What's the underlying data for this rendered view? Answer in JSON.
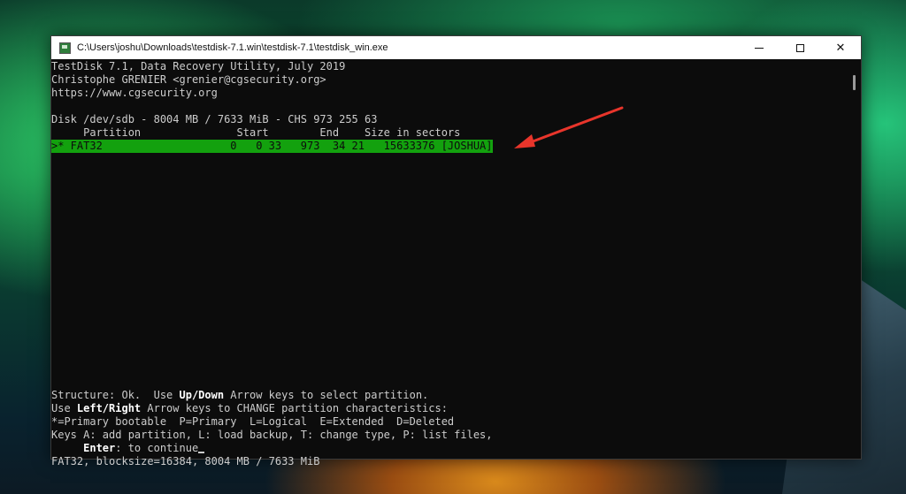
{
  "window": {
    "title": "C:\\Users\\joshu\\Downloads\\testdisk-7.1.win\\testdisk-7.1\\testdisk_win.exe",
    "controls": {
      "minimize": "—",
      "maximize": "□",
      "close": "✕"
    },
    "icon": "terminal-icon"
  },
  "console": {
    "header": [
      "TestDisk 7.1, Data Recovery Utility, July 2019",
      "Christophe GRENIER <grenier@cgsecurity.org>",
      "https://www.cgsecurity.org"
    ],
    "disk_line": "Disk /dev/sdb - 8004 MB / 7633 MiB - CHS 973 255 63",
    "table_header": "     Partition               Start        End    Size in sectors",
    "selected_partition": ">* FAT32                    0   0 33   973  34 21   15633376 [JOSHUA]",
    "footer": {
      "l1a": "Structure: Ok.  Use ",
      "l1b": "Up/Down",
      "l1c": " Arrow keys to select partition.",
      "l2a": "Use ",
      "l2b": "Left/Right",
      "l2c": " Arrow keys to CHANGE partition characteristics:",
      "l3": "*=Primary bootable  P=Primary  L=Logical  E=Extended  D=Deleted",
      "l4": "Keys A: add partition, L: load backup, T: change type, P: list files,",
      "l5a": "     Enter",
      "l5b": ": to continue",
      "l6": "FAT32, blocksize=16384, 8004 MB / 7633 MiB"
    }
  },
  "colors": {
    "console_bg": "#0c0c0c",
    "console_text": "#cccccc",
    "selection": "#13a10e",
    "arrow": "#e8352b"
  }
}
